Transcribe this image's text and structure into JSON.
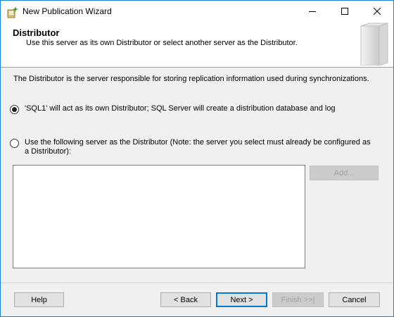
{
  "window": {
    "title": "New Publication Wizard",
    "icons": {
      "app": "wizard-icon",
      "minimize": "minimize-icon",
      "maximize": "maximize-icon",
      "close": "close-icon"
    }
  },
  "header": {
    "title": "Distributor",
    "subtitle": "Use this server as its own Distributor or select another server as the Distributor."
  },
  "body": {
    "description": "The Distributor is the server responsible for storing replication information used during synchronizations.",
    "options": [
      {
        "label": "'SQL1' will act as its own Distributor; SQL Server will create a distribution database and log",
        "checked": true
      },
      {
        "label": "Use the following server as the Distributor (Note: the server you select must already be configured as a Distributor):",
        "checked": false
      }
    ],
    "add_button": "Add..."
  },
  "footer": {
    "help": "Help",
    "back": "< Back",
    "next": "Next >",
    "finish": "Finish >>|",
    "cancel": "Cancel"
  }
}
